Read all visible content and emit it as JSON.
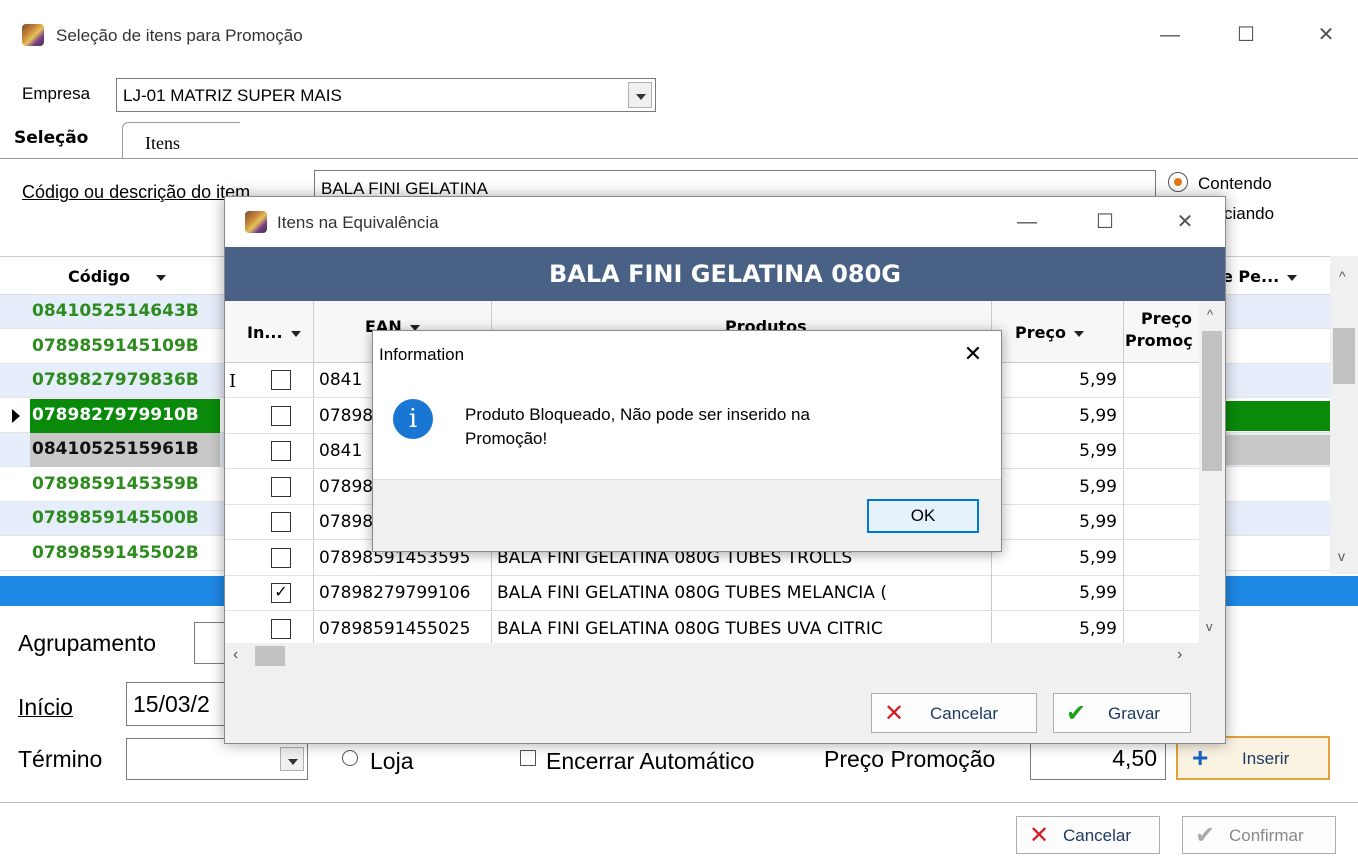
{
  "main_window": {
    "title": "Seleção de itens para Promoção",
    "empresa_label": "Empresa",
    "empresa_value": "LJ-01 MATRIZ SUPER MAIS",
    "tabs": [
      {
        "label": "Seleção"
      },
      {
        "label": "Itens"
      }
    ],
    "codigo_label": "Código ou descrição do item",
    "codigo_value": "BALA FINI GELATINA",
    "radio_contendo": "Contendo",
    "radio_iniciando": "ciando",
    "grid_header_codigo": "Código",
    "grid_header_right": "e Pe...",
    "grid_rows": [
      {
        "code": "0841052514643",
        "suffix": "B"
      },
      {
        "code": "0789859145109",
        "suffix": "B"
      },
      {
        "code": "0789827979836",
        "suffix": "B"
      },
      {
        "code": "0789827979910",
        "suffix": "B"
      },
      {
        "code": "0841052515961",
        "suffix": "B"
      },
      {
        "code": "0789859145359",
        "suffix": "B"
      },
      {
        "code": "0789859145500",
        "suffix": "B"
      },
      {
        "code": "0789859145502",
        "suffix": "B"
      }
    ],
    "agrupamento_label": "Agrupamento",
    "inicio_label": "Início",
    "inicio_value": "15/03/2",
    "termino_label": "Término",
    "loja_label": "Loja",
    "encerrar_label": "Encerrar Automático",
    "preco_promocao_label": "Preço Promoção",
    "preco_promocao_value": "4,50",
    "inserir_label": "Inserir",
    "cancelar_label": "Cancelar",
    "confirmar_label": "Confirmar"
  },
  "equiv_window": {
    "title": "Itens na Equivalência",
    "header": "BALA FINI GELATINA 080G",
    "columns": {
      "in": "In...",
      "ean": "EAN",
      "produtos": "Produtos",
      "preco": "Preço",
      "promo_top": "Preço",
      "promo_bottom": "Promoç"
    },
    "rows": [
      {
        "checked": false,
        "ean": "0841",
        "produto": "",
        "preco": "5,99"
      },
      {
        "checked": false,
        "ean": "07898",
        "produto": "",
        "preco": "5,99"
      },
      {
        "checked": false,
        "ean": "0841",
        "produto": "",
        "preco": "5,99"
      },
      {
        "checked": false,
        "ean": "07898",
        "produto": "",
        "preco": "5,99"
      },
      {
        "checked": false,
        "ean": "07898",
        "produto": "",
        "preco": "5,99"
      },
      {
        "checked": false,
        "ean": "07898591453595",
        "produto": "BALA FINI GELATINA 080G TUBES TROLLS",
        "preco": "5,99"
      },
      {
        "checked": true,
        "ean": "07898279799106",
        "produto": "BALA FINI GELATINA 080G TUBES MELANCIA (",
        "preco": "5,99"
      },
      {
        "checked": false,
        "ean": "07898591455025",
        "produto": "BALA FINI GELATINA 080G TUBES UVA CITRIC",
        "preco": "5,99"
      }
    ],
    "cancelar_label": "Cancelar",
    "gravar_label": "Gravar"
  },
  "info_dialog": {
    "title": "Information",
    "message_line1": "Produto Bloqueado, Não pode ser inserido na",
    "message_line2": "Promoção!",
    "ok_label": "OK"
  },
  "colors": {
    "equiv_header_bg": "#4a6186",
    "blue_bar": "#1e88e5",
    "selected_row": "#0a8a0a",
    "grey_row": "#c8c8c8",
    "code_green": "#2e8b1e"
  }
}
